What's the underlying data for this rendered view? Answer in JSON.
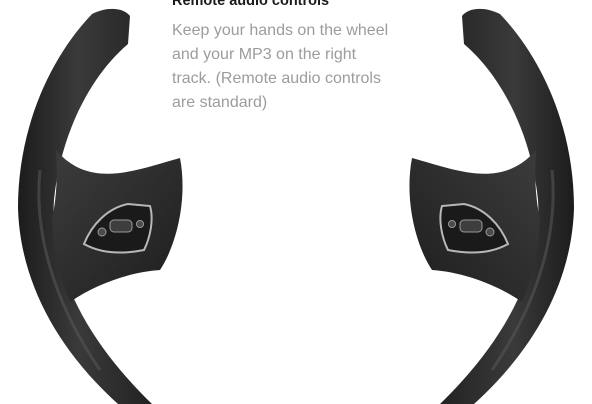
{
  "feature": {
    "heading": "Remote audio controls",
    "body_lines": [
      "Keep your hands on the wheel",
      "and your MP3 on the right",
      "track. (Remote audio controls",
      "are standard)"
    ]
  },
  "colors": {
    "heading_text": "#1b1b1b",
    "body_text": "#9c9c9c",
    "wheel_leather": "#2c2c2c",
    "control_trim": "#b8b8b8",
    "background": "#ffffff"
  },
  "icons": {
    "wheel": "steering-wheel-illustration",
    "left_controls": "left-audio-control-pad-icon",
    "right_controls": "right-audio-control-pad-icon"
  }
}
